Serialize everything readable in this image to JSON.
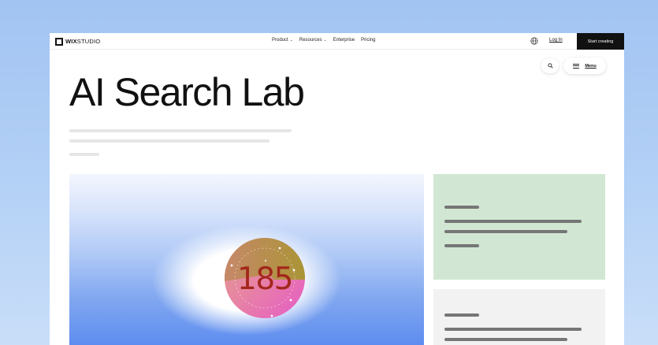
{
  "header": {
    "logo_bold": "WIX",
    "logo_rest": "STUDIO",
    "nav": [
      {
        "label": "Product",
        "has_menu": true
      },
      {
        "label": "Resources",
        "has_menu": true
      },
      {
        "label": "Enterprise",
        "has_menu": false
      },
      {
        "label": "Pricing",
        "has_menu": false
      }
    ],
    "chevron": "⌄",
    "login": "Log In",
    "cta": "Start creating"
  },
  "floating": {
    "menu_label": "Menu"
  },
  "page": {
    "title": "AI Search Lab"
  },
  "hero": {
    "counter": "185"
  },
  "icons": [
    "wix-logo-icon",
    "globe-icon",
    "search-icon",
    "hamburger-icon",
    "chevron-down-icon"
  ],
  "colors": {
    "accent_dark": "#111111",
    "card_green": "#d1e7d3",
    "card_grey": "#f2f2f2",
    "hero_blue": "#5e8df0",
    "counter_text": "#a3271c"
  }
}
